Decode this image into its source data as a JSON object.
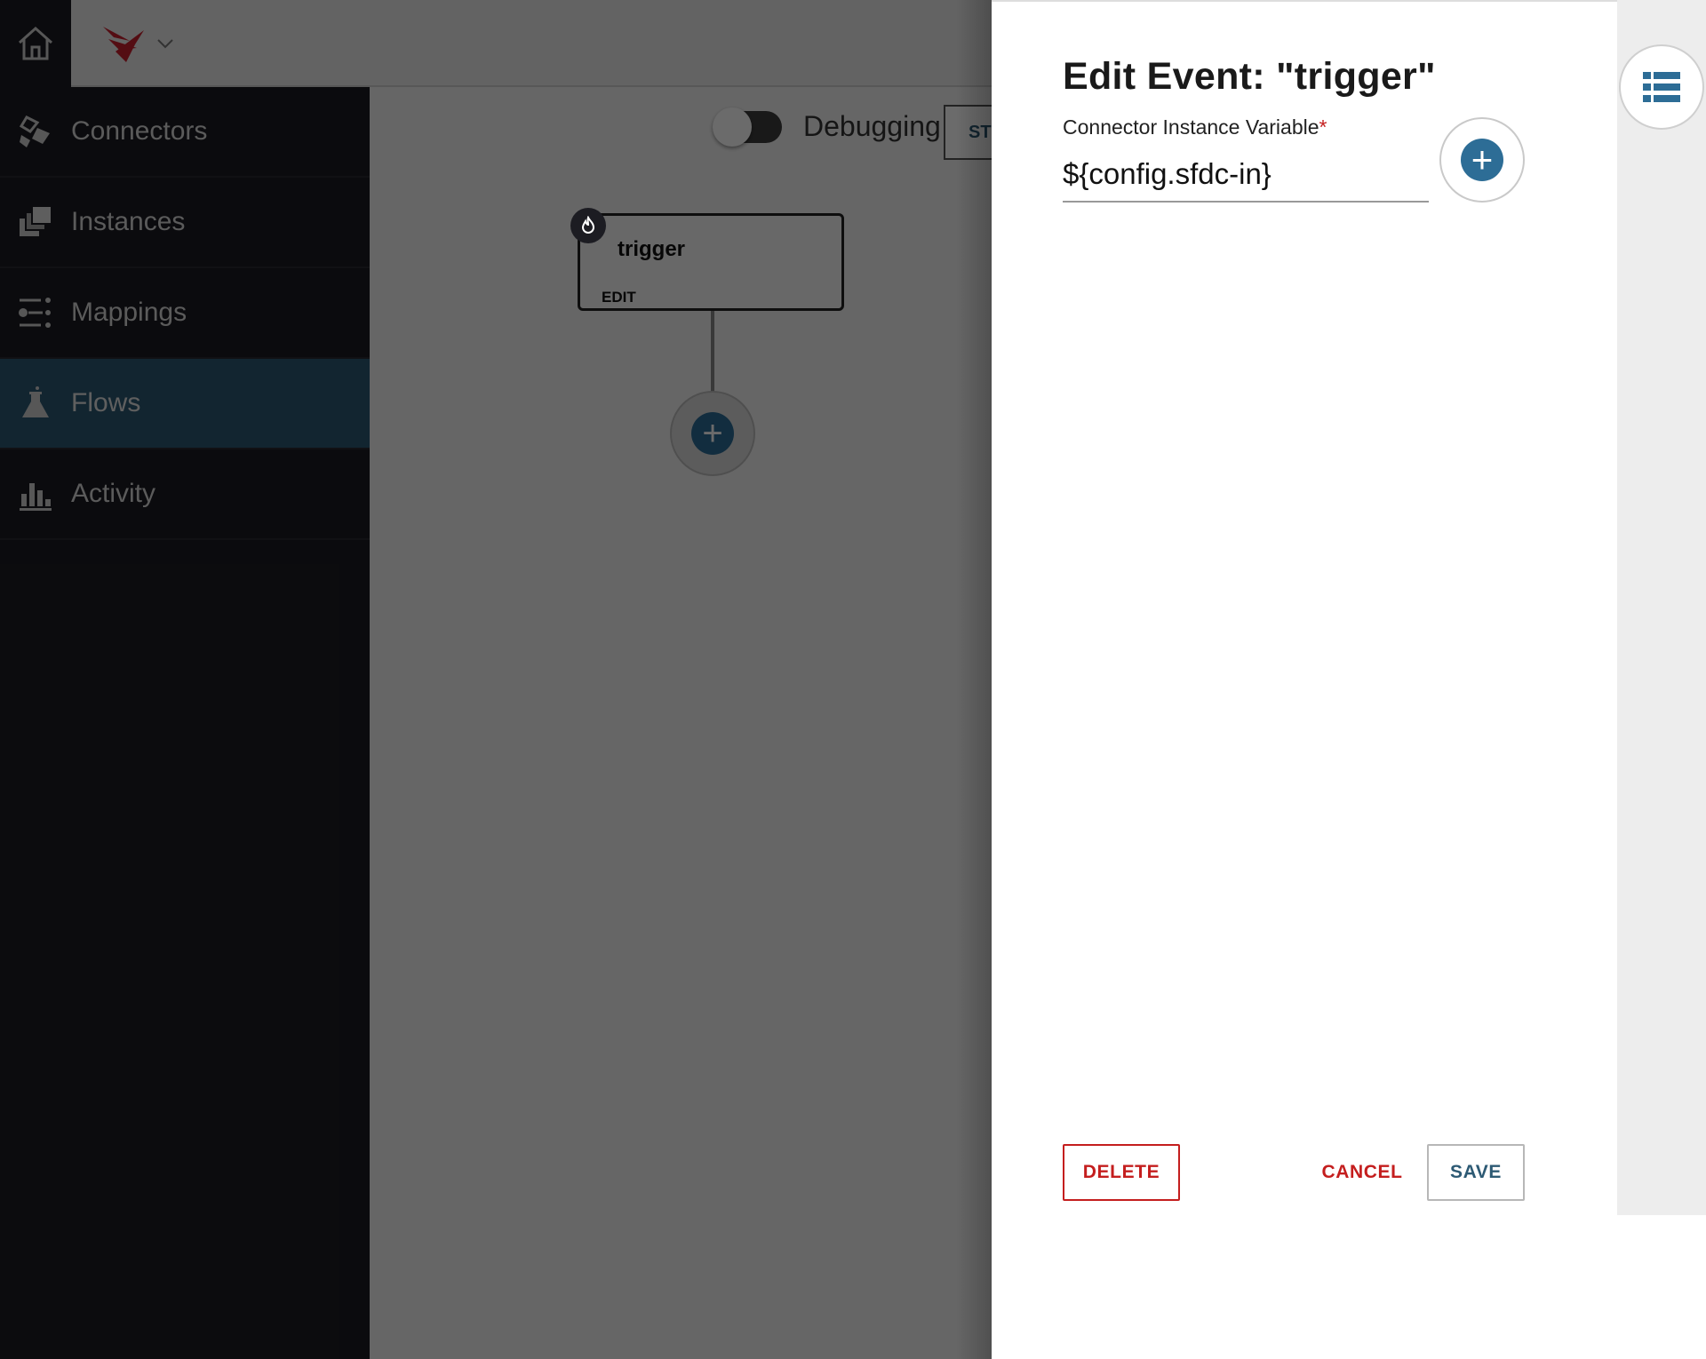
{
  "header": {
    "home_icon": "home-icon",
    "brand_icon": "brand-logo-icon",
    "brand_menu_icon": "chevron-down-icon"
  },
  "sidebar": {
    "items": [
      {
        "label": "Connectors",
        "icon": "connectors-icon",
        "active": false
      },
      {
        "label": "Instances",
        "icon": "instances-icon",
        "active": false
      },
      {
        "label": "Mappings",
        "icon": "mappings-icon",
        "active": false
      },
      {
        "label": "Flows",
        "icon": "flask-icon",
        "active": true
      },
      {
        "label": "Activity",
        "icon": "bar-chart-icon",
        "active": false
      }
    ]
  },
  "canvas": {
    "debug_label": "Debugging",
    "debug_on": false,
    "start_label": "ST",
    "trigger": {
      "name": "trigger",
      "edit_label": "EDIT",
      "badge_icon": "trigger-icon"
    },
    "add_step_icon": "plus-icon"
  },
  "panel": {
    "title": "Edit Event: \"trigger\"",
    "field_label": "Connector Instance Variable",
    "required_mark": "*",
    "field_value": "${config.sfdc-in}",
    "add_variable_icon": "plus-icon",
    "delete_label": "DELETE",
    "cancel_label": "CANCEL",
    "save_label": "SAVE",
    "rail_icon": "list-icon"
  },
  "colors": {
    "sidebar_bg": "#1c1c22",
    "active_nav": "#2d5a74",
    "accent_blue": "#2d6d96",
    "danger_red": "#c41e1e",
    "brand_red": "#c8202e"
  }
}
